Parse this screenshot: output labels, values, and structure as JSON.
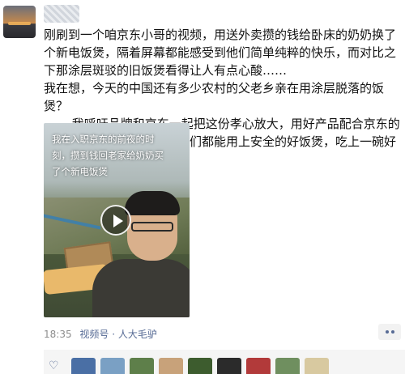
{
  "post": {
    "line1": "刚刷到一个咱京东小哥的视频，用送外卖攒的钱给卧床的奶奶换了个新电饭煲，隔着屏幕都能感受到他们简单纯粹的快乐，而对比之下那涂层斑驳的旧饭煲看得让人有点心酸……",
    "line2": "我在想，今天的中国还有多少农村的父老乡亲在用涂层脱落的饭煲？",
    "line3": "—— 我呼吁品牌和京东一起把这份孝心放大，用好产品配合京东的以旧换新，让广大父老乡亲们都能用上安全的好饭煲，吃上一碗好饭！"
  },
  "video": {
    "caption": "我在入职京东的前夜的时刻，攒到钱回老家给奶奶买了个新电饭煲",
    "play_icon": "play-icon"
  },
  "meta": {
    "time": "18:35",
    "source": "视频号 · 人大毛驴"
  },
  "likes": {
    "icon": "heart-icon",
    "avatar_colors": [
      "#4a6fa5",
      "#7aa0c4",
      "#5e7f4a",
      "#c8a27a",
      "#3d5c2e",
      "#2b2b2b",
      "#b23a3a",
      "#6f8f5f",
      "#d8c9a0"
    ]
  }
}
